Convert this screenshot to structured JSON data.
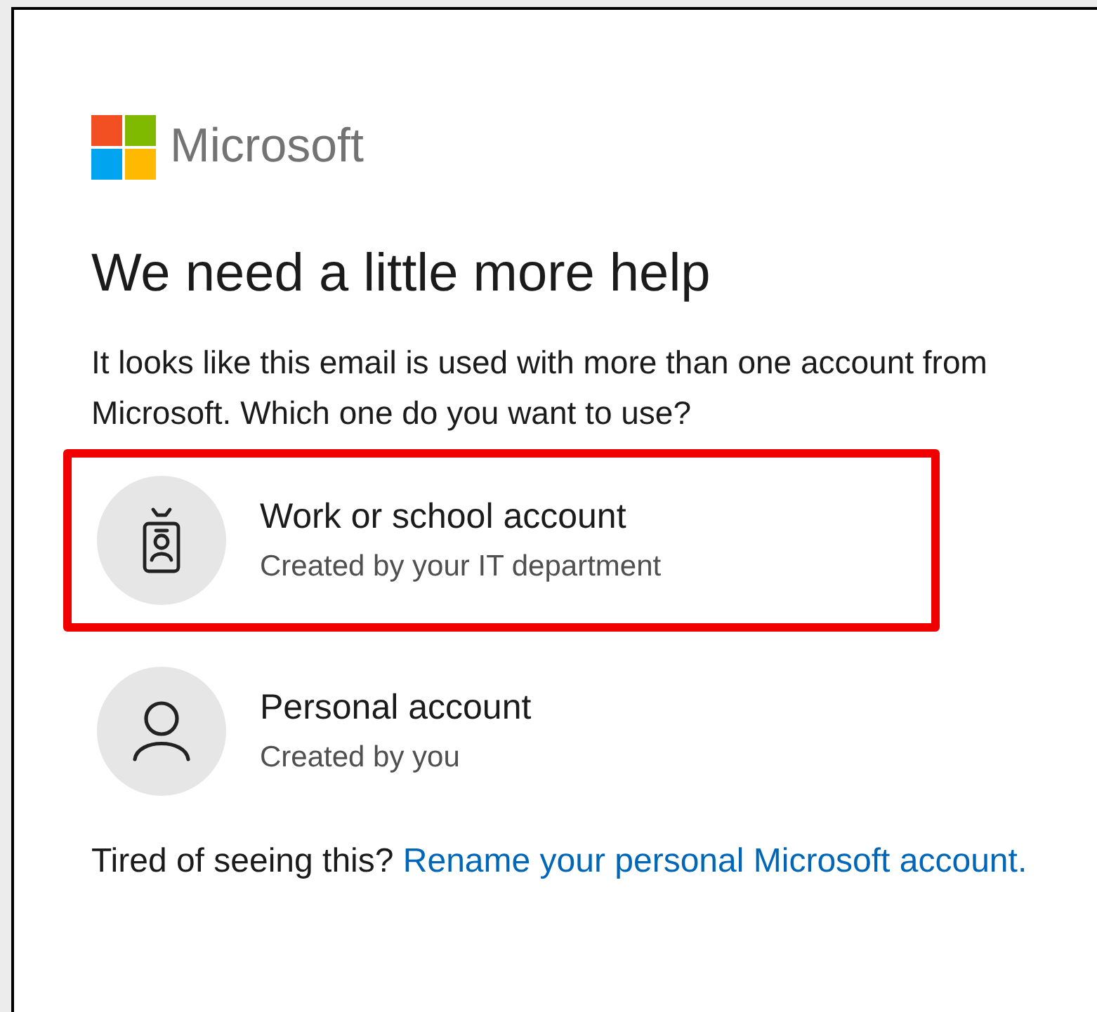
{
  "brand": {
    "name": "Microsoft"
  },
  "heading": "We need a little more help",
  "message": "It looks like this email is used with more than one account from Microsoft. Which one do you want to use?",
  "options": [
    {
      "kind": "work",
      "title": "Work or school account",
      "subtitle": "Created by your IT department",
      "highlighted": true
    },
    {
      "kind": "personal",
      "title": "Personal account",
      "subtitle": "Created by you",
      "highlighted": false
    }
  ],
  "footer": {
    "text": "Tired of seeing this?",
    "link": "Rename your personal Microsoft account."
  }
}
